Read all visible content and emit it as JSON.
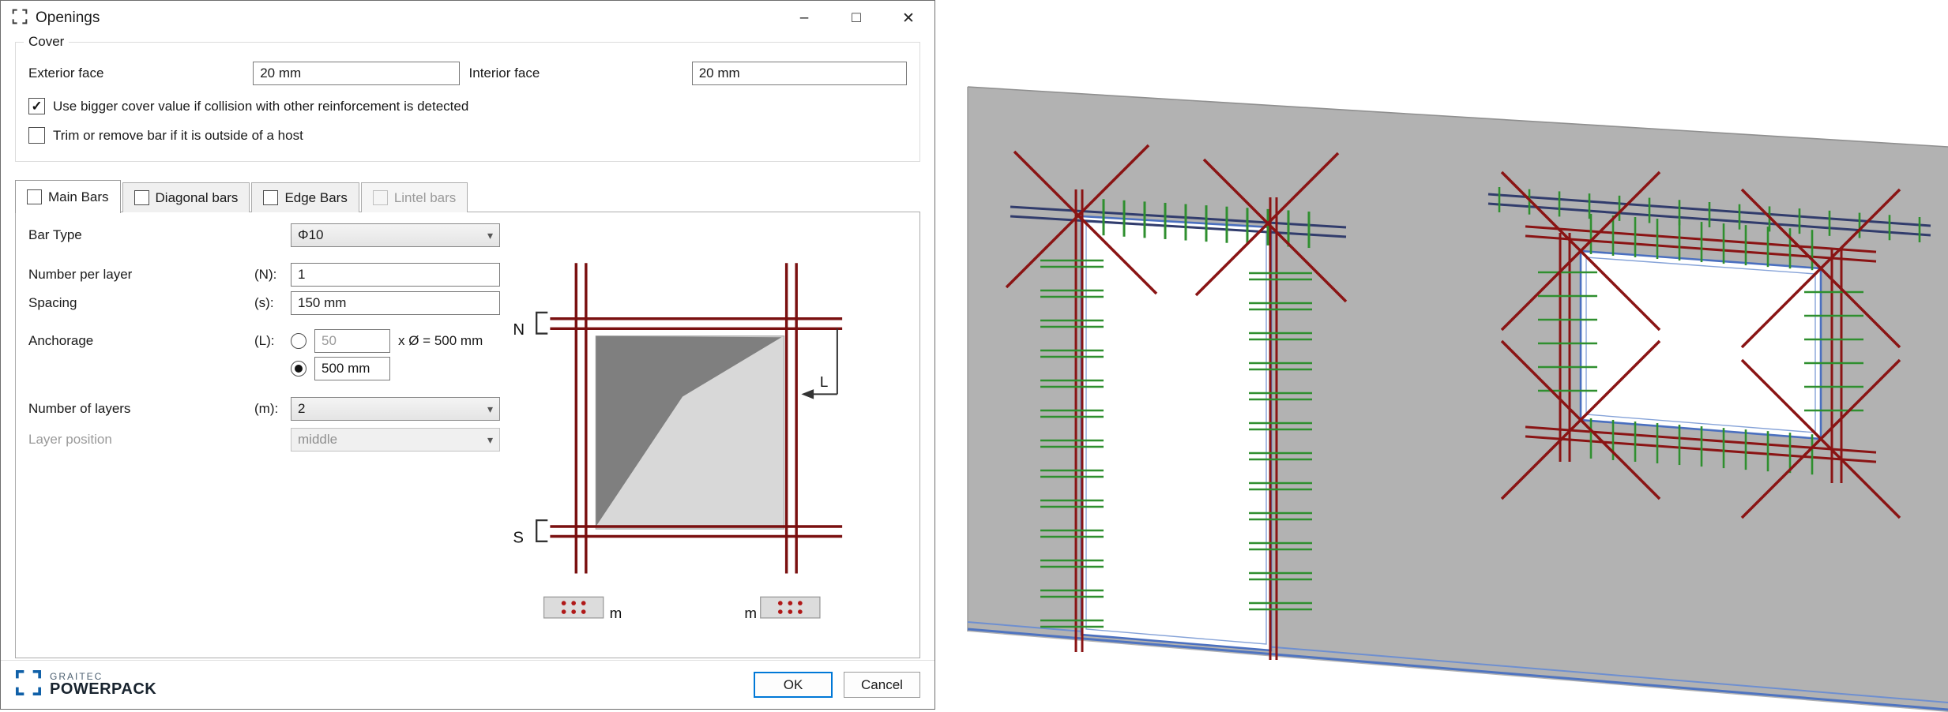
{
  "window": {
    "title": "Openings",
    "controls": {
      "minimize": "–",
      "maximize": "□",
      "close": "✕"
    }
  },
  "cover": {
    "group_label": "Cover",
    "exterior_label": "Exterior face",
    "exterior_value": "20 mm",
    "interior_label": "Interior face",
    "interior_value": "20 mm",
    "bigger_cover_checkbox": {
      "label": "Use bigger cover value if collision with other reinforcement is detected",
      "checked": true
    },
    "trim_checkbox": {
      "label": "Trim or remove bar if it is outside of a host",
      "checked": false
    }
  },
  "tabs": [
    {
      "label": "Main Bars",
      "checked": false,
      "active": true,
      "disabled": false
    },
    {
      "label": "Diagonal bars",
      "checked": false,
      "active": false,
      "disabled": false
    },
    {
      "label": "Edge Bars",
      "checked": false,
      "active": false,
      "disabled": false
    },
    {
      "label": "Lintel bars",
      "checked": false,
      "active": false,
      "disabled": true
    }
  ],
  "main_bars": {
    "bar_type_label": "Bar Type",
    "bar_type_value": "Φ10",
    "number_per_layer_label": "Number per layer",
    "number_per_layer_symbol": "(N):",
    "number_per_layer_value": "1",
    "spacing_label": "Spacing",
    "spacing_symbol": "(s):",
    "spacing_value": "150 mm",
    "anchorage_label": "Anchorage",
    "anchorage_symbol": "(L):",
    "anchorage_factor_value": "50",
    "anchorage_factor_suffix": "x Ø = 500 mm",
    "anchorage_length_value": "500 mm",
    "anchorage_selected": "length",
    "layers_label": "Number of layers",
    "layers_symbol": "(m):",
    "layers_value": "2",
    "layer_position_label": "Layer position",
    "layer_position_value": "middle"
  },
  "diagram": {
    "north_label": "N",
    "south_label": "S",
    "length_label": "L",
    "layer_label_left": "m",
    "layer_label_right": "m"
  },
  "footer": {
    "brand_top": "GRAITEC",
    "brand_bottom": "POWERPACK",
    "ok_label": "OK",
    "cancel_label": "Cancel"
  },
  "colors": {
    "bar_red": "#8a1414",
    "bar_green": "#2f8f2f",
    "bar_navy": "#313c6c",
    "opening_blue": "#4a6fbf",
    "opening_blue_light": "#86a3d8",
    "slab_blue": "#4f74c0",
    "wall_gray": "#b2b2b2",
    "accent_blue": "#0078d7"
  }
}
